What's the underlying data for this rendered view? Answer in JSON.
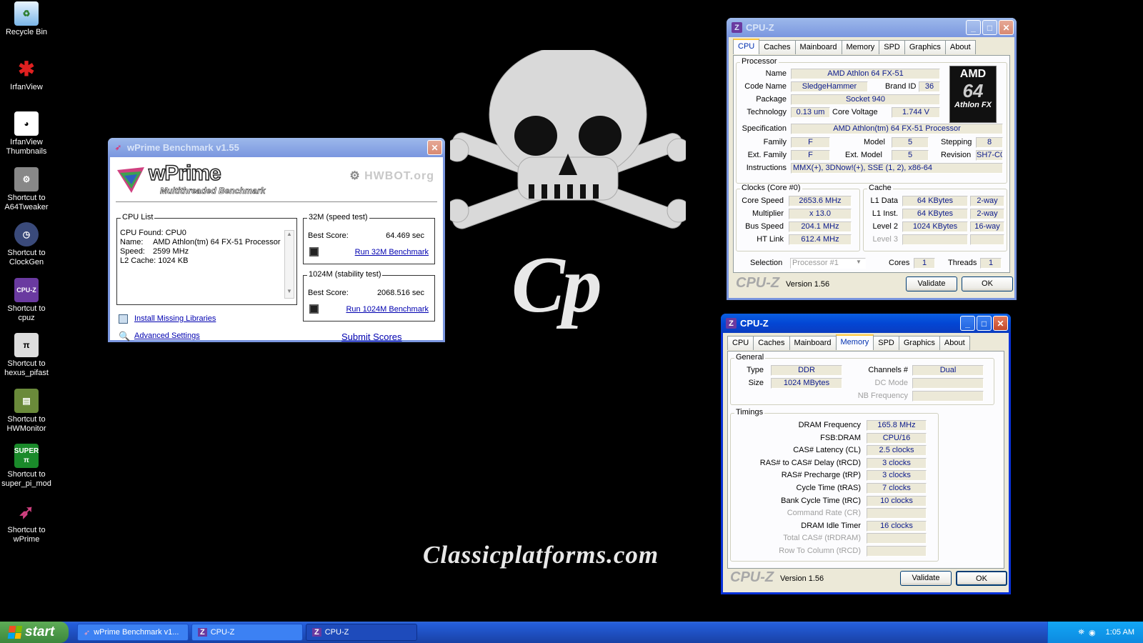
{
  "desktop": {
    "icons": [
      {
        "label": "Recycle Bin",
        "icon": "recycle-bin-icon"
      },
      {
        "label": "IrfanView",
        "icon": "irfanview-icon"
      },
      {
        "label": "IrfanView Thumbnails",
        "icon": "irfanview-thumbnails-icon"
      },
      {
        "label": "Shortcut to A64Tweaker",
        "icon": "a64tweaker-icon"
      },
      {
        "label": "Shortcut to ClockGen",
        "icon": "clockgen-icon"
      },
      {
        "label": "Shortcut to cpuz",
        "icon": "cpuz-icon"
      },
      {
        "label": "Shortcut to hexus_pifast",
        "icon": "pifast-icon"
      },
      {
        "label": "Shortcut to HWMonitor",
        "icon": "hwmonitor-icon"
      },
      {
        "label": "Shortcut to super_pi_mod",
        "icon": "superpi-icon"
      },
      {
        "label": "Shortcut to wPrime",
        "icon": "wprime-icon"
      }
    ],
    "wallpaper": {
      "logo": "Cp",
      "url": "Classicplatforms.com"
    }
  },
  "wprime": {
    "title": "wPrime Benchmark v1.55",
    "logo": "wPrime",
    "subtitle": "Multithreaded Benchmark",
    "hwbot": "HWBOT.org",
    "cpu_list_label": "CPU List",
    "cpu_found": "CPU Found: CPU0",
    "name_label": "Name:",
    "name_value": "AMD Athlon(tm) 64 FX-51 Processor",
    "speed_label": "Speed:",
    "speed_value": "2599 MHz",
    "l2_cache": "L2 Cache: 1024 KB",
    "speed_test_label": "32M (speed test)",
    "best_score_label": "Best Score:",
    "speed_best": "64.469 sec",
    "run_32m": "Run 32M Benchmark",
    "stability_label": "1024M (stability test)",
    "stability_best": "2068.516 sec",
    "run_1024m": "Run 1024M Benchmark",
    "install_libs": "Install Missing Libraries",
    "advanced_settings": "Advanced Settings",
    "submit_scores": "Submit Scores"
  },
  "cpuz_cpu": {
    "title": "CPU-Z",
    "tabs": [
      "CPU",
      "Caches",
      "Mainboard",
      "Memory",
      "SPD",
      "Graphics",
      "About"
    ],
    "active_tab": "CPU",
    "processor_label": "Processor",
    "name_label": "Name",
    "name": "AMD Athlon 64 FX-51",
    "codename_label": "Code Name",
    "codename": "SledgeHammer",
    "brandid_label": "Brand ID",
    "brandid": "36",
    "package_label": "Package",
    "package": "Socket 940",
    "technology_label": "Technology",
    "technology": "0.13 um",
    "corevoltage_label": "Core Voltage",
    "corevoltage": "1.744 V",
    "spec_label": "Specification",
    "spec": "AMD Athlon(tm) 64 FX-51 Processor",
    "family_label": "Family",
    "family": "F",
    "model_label": "Model",
    "model": "5",
    "stepping_label": "Stepping",
    "stepping": "8",
    "extfamily_label": "Ext. Family",
    "extfamily": "F",
    "extmodel_label": "Ext. Model",
    "extmodel": "5",
    "revision_label": "Revision",
    "revision": "SH7-C0",
    "instructions_label": "Instructions",
    "instructions": "MMX(+), 3DNow!(+), SSE (1, 2), x86-64",
    "clocks_label": "Clocks (Core #0)",
    "corespeed_label": "Core Speed",
    "corespeed": "2653.6 MHz",
    "multiplier_label": "Multiplier",
    "multiplier": "x 13.0",
    "busspeed_label": "Bus Speed",
    "busspeed": "204.1 MHz",
    "htlink_label": "HT Link",
    "htlink": "612.4 MHz",
    "cache_label": "Cache",
    "l1data_label": "L1 Data",
    "l1data": "64 KBytes",
    "l1data_way": "2-way",
    "l1inst_label": "L1 Inst.",
    "l1inst": "64 KBytes",
    "l1inst_way": "2-way",
    "level2_label": "Level 2",
    "level2": "1024 KBytes",
    "level2_way": "16-way",
    "level3_label": "Level 3",
    "selection_label": "Selection",
    "selection": "Processor #1",
    "cores_label": "Cores",
    "cores": "1",
    "threads_label": "Threads",
    "threads": "1",
    "logo_line1": "AMD",
    "logo_line2": "64",
    "logo_line3": "Athlon FX",
    "brand": "CPU-Z",
    "version": "Version 1.56",
    "validate": "Validate",
    "ok": "OK"
  },
  "cpuz_mem": {
    "title": "CPU-Z",
    "tabs": [
      "CPU",
      "Caches",
      "Mainboard",
      "Memory",
      "SPD",
      "Graphics",
      "About"
    ],
    "active_tab": "Memory",
    "general_label": "General",
    "type_label": "Type",
    "type": "DDR",
    "size_label": "Size",
    "size": "1024 MBytes",
    "channels_label": "Channels #",
    "channels": "Dual",
    "dcmode_label": "DC Mode",
    "nbfreq_label": "NB Frequency",
    "timings_label": "Timings",
    "timings": [
      {
        "label": "DRAM Frequency",
        "value": "165.8 MHz",
        "dim": false
      },
      {
        "label": "FSB:DRAM",
        "value": "CPU/16",
        "dim": false
      },
      {
        "label": "CAS# Latency (CL)",
        "value": "2.5 clocks",
        "dim": false
      },
      {
        "label": "RAS# to CAS# Delay (tRCD)",
        "value": "3 clocks",
        "dim": false
      },
      {
        "label": "RAS# Precharge (tRP)",
        "value": "3 clocks",
        "dim": false
      },
      {
        "label": "Cycle Time (tRAS)",
        "value": "7 clocks",
        "dim": false
      },
      {
        "label": "Bank Cycle Time (tRC)",
        "value": "10 clocks",
        "dim": false
      },
      {
        "label": "Command Rate (CR)",
        "value": "",
        "dim": true
      },
      {
        "label": "DRAM Idle Timer",
        "value": "16 clocks",
        "dim": false
      },
      {
        "label": "Total CAS# (tRDRAM)",
        "value": "",
        "dim": true
      },
      {
        "label": "Row To Column (tRCD)",
        "value": "",
        "dim": true
      }
    ],
    "brand": "CPU-Z",
    "version": "Version 1.56",
    "validate": "Validate",
    "ok": "OK"
  },
  "taskbar": {
    "start": "start",
    "items": [
      {
        "label": "wPrime Benchmark v1...",
        "icon": "wprime-icon"
      },
      {
        "label": "CPU-Z",
        "icon": "cpuz-icon"
      },
      {
        "label": "CPU-Z",
        "icon": "cpuz-icon"
      }
    ],
    "clock": "1:05 AM"
  }
}
